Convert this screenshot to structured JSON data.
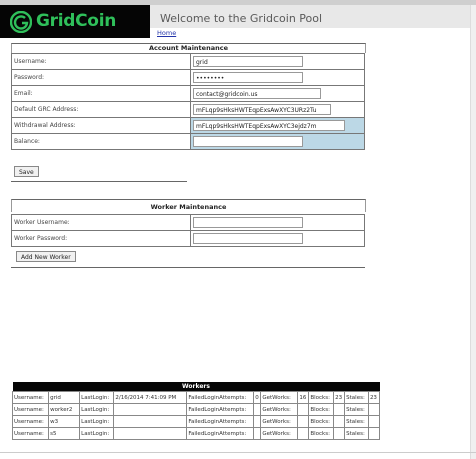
{
  "header": {
    "logo_text": "GridCoin",
    "welcome": "Welcome to the Gridcoin Pool",
    "home_link": "Home"
  },
  "account": {
    "title": "Account Maintenance",
    "rows": [
      {
        "label": "Username:",
        "value": "grid"
      },
      {
        "label": "Password:",
        "value": "••••••••"
      },
      {
        "label": "Email:",
        "value": "contact@gridcoin.us"
      },
      {
        "label": "Default GRC Address:",
        "value": "mFLqp9sHksHWTEqpExsAwXYC3URz2Tu"
      },
      {
        "label": "Withdrawal Address:",
        "value": "mFLqp9sHksHWTEqpExsAwXYC3ejdz7m"
      },
      {
        "label": "Balance:",
        "value": ""
      }
    ],
    "save_label": "Save"
  },
  "worker": {
    "title": "Worker Maintenance",
    "rows": [
      {
        "label": "Worker Username:",
        "value": ""
      },
      {
        "label": "Worker Password:",
        "value": ""
      }
    ],
    "add_label": "Add New Worker"
  },
  "workers_table": {
    "title": "Workers",
    "rows": [
      {
        "username_label": "Username:",
        "username": "grid",
        "lastlogin_label": "LastLogin:",
        "lastlogin": "2/16/2014 7:41:09 PM",
        "failed_label": "FailedLoginAttempts:",
        "failed": "0",
        "gw_label": "GetWorks:",
        "gw": "16",
        "blocks_label": "Blocks:",
        "blocks": "23",
        "stales_label": "Stales:",
        "stales": "23"
      },
      {
        "username_label": "Username:",
        "username": "worker2",
        "lastlogin_label": "LastLogin:",
        "lastlogin": "",
        "failed_label": "FailedLoginAttempts:",
        "failed": "",
        "gw_label": "GetWorks:",
        "gw": "",
        "blocks_label": "Blocks:",
        "blocks": "",
        "stales_label": "Stales:",
        "stales": ""
      },
      {
        "username_label": "Username:",
        "username": "w3",
        "lastlogin_label": "LastLogin:",
        "lastlogin": "",
        "failed_label": "FailedLoginAttempts:",
        "failed": "",
        "gw_label": "GetWorks:",
        "gw": "",
        "blocks_label": "Blocks:",
        "blocks": "",
        "stales_label": "Stales:",
        "stales": ""
      },
      {
        "username_label": "Username:",
        "username": "s5",
        "lastlogin_label": "LastLogin:",
        "lastlogin": "",
        "failed_label": "FailedLoginAttempts:",
        "failed": "",
        "gw_label": "GetWorks:",
        "gw": "",
        "blocks_label": "Blocks:",
        "blocks": "",
        "stales_label": "Stales:",
        "stales": ""
      }
    ]
  },
  "colors": {
    "logo_green": "#2fbf5a",
    "highlight": "#bcd8e6",
    "header_black": "#050505"
  }
}
